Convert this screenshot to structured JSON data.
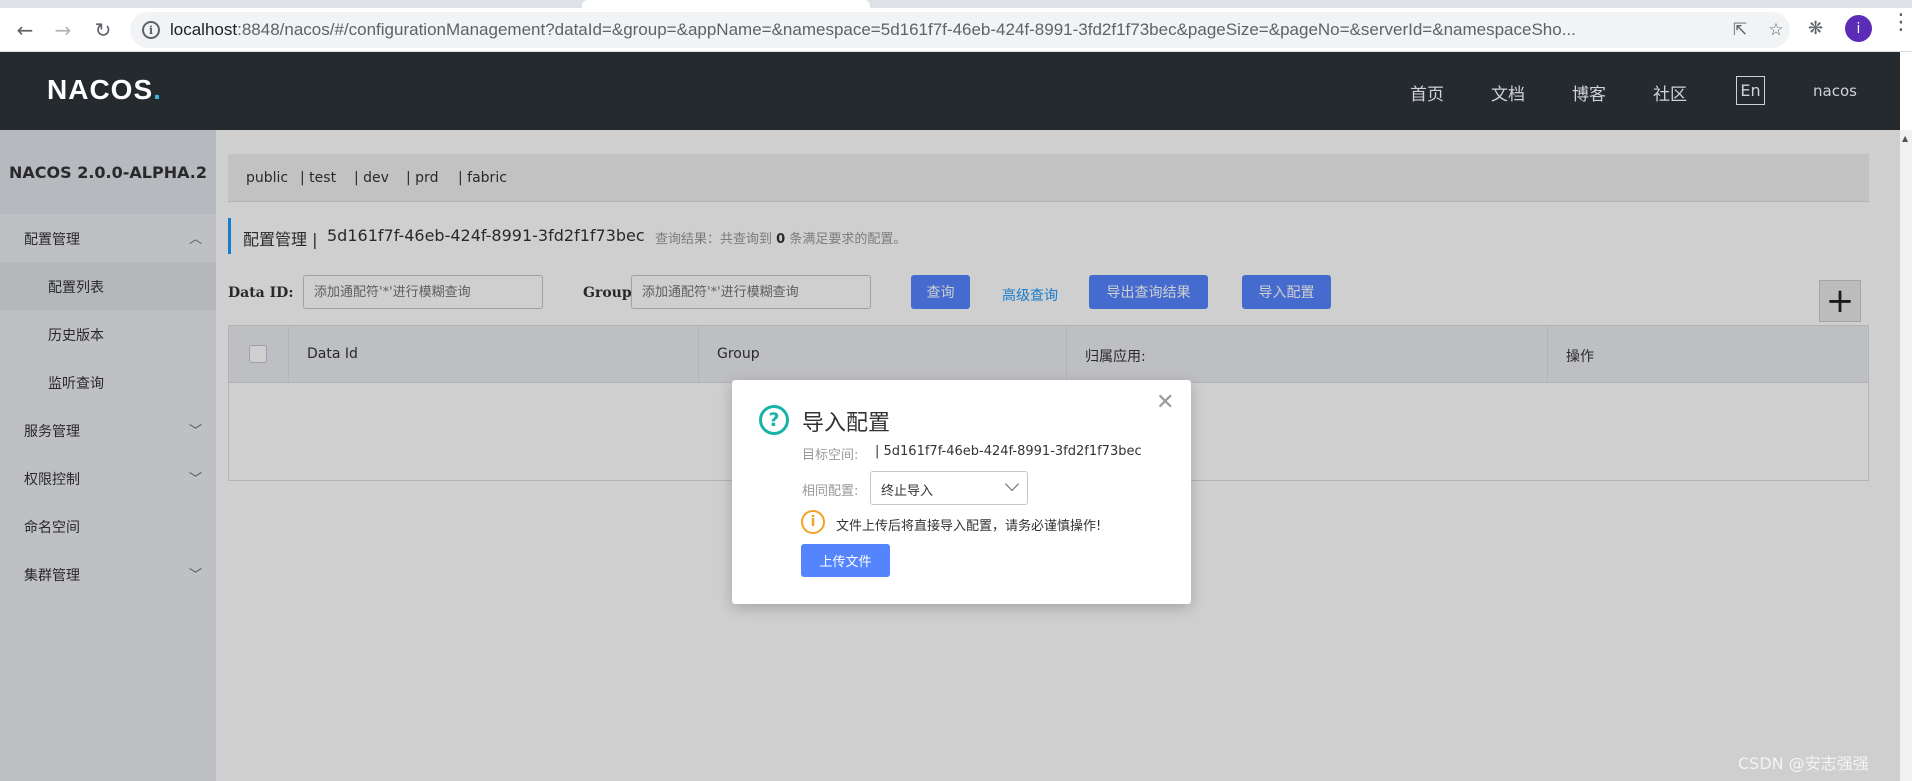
{
  "browser": {
    "url_host": "localhost",
    "url_path": ":8848/nacos/#/configurationManagement?dataId=&group=&appName=&namespace=5d161f7f-46eb-424f-8991-3fd2f1f73bec&pageSize=&pageNo=&serverId=&namespaceSho..."
  },
  "header": {
    "logo_main": "NACOS",
    "logo_dot": ".",
    "nav": [
      "首页",
      "文档",
      "博客",
      "社区"
    ],
    "lang": "En",
    "user": "nacos"
  },
  "sidebar": {
    "version": "NACOS 2.0.0-ALPHA.2",
    "items": [
      {
        "label": "配置管理",
        "chevron": "︿"
      },
      {
        "label": "配置列表"
      },
      {
        "label": "历史版本"
      },
      {
        "label": "监听查询"
      },
      {
        "label": "服务管理",
        "chevron": "﹀"
      },
      {
        "label": "权限控制",
        "chevron": "﹀"
      },
      {
        "label": "命名空间"
      },
      {
        "label": "集群管理",
        "chevron": "﹀"
      }
    ]
  },
  "namespaces": [
    "public",
    "| test",
    "| dev",
    "| prd",
    "| fabric"
  ],
  "title": {
    "section": "配置管理  |",
    "namespace": "5d161f7f-46eb-424f-8991-3fd2f1f73bec",
    "result_prefix": "查询结果：共查询到",
    "result_count": "0",
    "result_suffix": "条满足要求的配置。"
  },
  "query": {
    "dataid_label": "Data ID:",
    "dataid_placeholder": "添加通配符'*'进行模糊查询",
    "group_label": "Group:",
    "group_placeholder": "添加通配符'*'进行模糊查询",
    "search_btn": "查询",
    "advanced": "高级查询",
    "export_btn": "导出查询结果",
    "import_btn": "导入配置",
    "add_btn": "+"
  },
  "table": {
    "columns": [
      "Data Id",
      "Group",
      "归属应用:",
      "操作"
    ]
  },
  "dialog": {
    "title": "导入配置",
    "target_label": "目标空间:",
    "target_value": "| 5d161f7f-46eb-424f-8991-3fd2f1f73bec",
    "same_label": "相同配置:",
    "same_value": "终止导入",
    "warning": "文件上传后将直接导入配置，请务必谨慎操作!",
    "upload_btn": "上传文件",
    "close": "✕"
  },
  "watermark": "CSDN @安志强强"
}
